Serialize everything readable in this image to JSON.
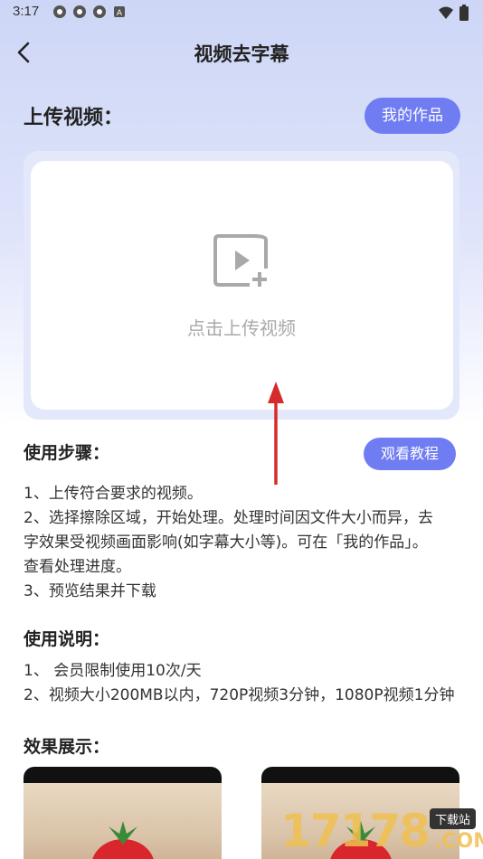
{
  "status": {
    "time": "3:17",
    "notification_icons": [
      "pinwheel-icon",
      "pinwheel-icon",
      "pinwheel-icon",
      "app-a-icon"
    ],
    "right_icons": [
      "wifi-icon",
      "battery-icon"
    ]
  },
  "header": {
    "title": "视频去字幕",
    "back_icon": "chevron-left-icon"
  },
  "upload": {
    "title": "上传视频：",
    "works_button": "我的作品",
    "drop_label": "点击上传视频",
    "icon": "video-add-icon"
  },
  "steps": {
    "title": "使用步骤：",
    "tutorial_button": "观看教程",
    "lines": [
      "1、上传符合要求的视频。",
      "2、选择擦除区域，开始处理。处理时间因文件大小而异，去",
      "字效果受视频画面影响(如字幕大小等)。可在「我的作品」。",
      "查看处理进度。",
      "3、预览结果并下载"
    ]
  },
  "notes": {
    "title": "使用说明：",
    "lines": [
      "1、 会员限制使用10次/天",
      "2、视频大小200MB以内，720P视频3分钟，1080P视频1分钟"
    ]
  },
  "effect": {
    "title": "效果展示："
  },
  "watermark": {
    "digits": "17178",
    "tag": "下载站",
    "domain": ".COM"
  },
  "colors": {
    "accent": "#6f7cf2",
    "annotation_arrow": "#d62b2b"
  }
}
